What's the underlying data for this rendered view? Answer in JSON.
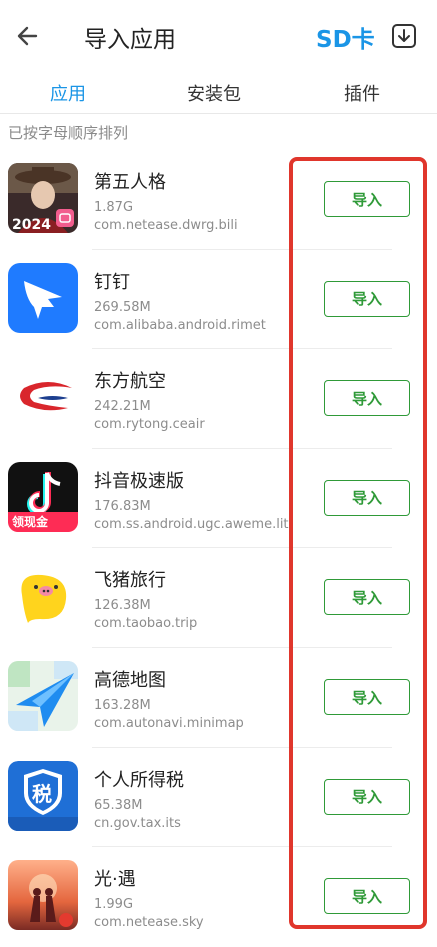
{
  "header": {
    "title": "导入应用",
    "sd_card_label": "SD卡"
  },
  "tabs": [
    {
      "label": "应用",
      "active": true
    },
    {
      "label": "安装包",
      "active": false
    },
    {
      "label": "插件",
      "active": false
    }
  ],
  "sort_note": "已按字母顺序排列",
  "apps": [
    {
      "name": "第五人格",
      "size": "1.87G",
      "package": "com.netease.dwrg.bili",
      "button": "导入",
      "icon": "identity-v-icon"
    },
    {
      "name": "钉钉",
      "size": "269.58M",
      "package": "com.alibaba.android.rimet",
      "button": "导入",
      "icon": "dingtalk-icon"
    },
    {
      "name": "东方航空",
      "size": "242.21M",
      "package": "com.rytong.ceair",
      "button": "导入",
      "icon": "china-eastern-icon"
    },
    {
      "name": "抖音极速版",
      "size": "176.83M",
      "package": "com.ss.android.ugc.aweme.lite",
      "button": "导入",
      "icon": "douyin-lite-icon",
      "icon_badge": "领现金"
    },
    {
      "name": "飞猪旅行",
      "size": "126.38M",
      "package": "com.taobao.trip",
      "button": "导入",
      "icon": "fliggy-icon"
    },
    {
      "name": "高德地图",
      "size": "163.28M",
      "package": "com.autonavi.minimap",
      "button": "导入",
      "icon": "amap-icon"
    },
    {
      "name": "个人所得税",
      "size": "65.38M",
      "package": "cn.gov.tax.its",
      "button": "导入",
      "icon": "individual-tax-icon",
      "icon_text": "税"
    },
    {
      "name": "光·遇",
      "size": "1.99G",
      "package": "com.netease.sky",
      "button": "导入",
      "icon": "sky-icon"
    }
  ],
  "colors": {
    "accent": "#1a95e6",
    "import_green": "#2f9a38",
    "highlight_red": "#e0362c"
  }
}
